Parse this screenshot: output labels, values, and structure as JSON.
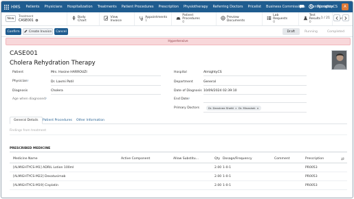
{
  "nav": {
    "app": "HMS",
    "menu": [
      "Patients",
      "Physicians",
      "Hospitalization",
      "Treatments",
      "Patient Procedures",
      "Prescription",
      "Physiotherapy",
      "Referring Doctors",
      "Pricelist",
      "Business Commissions",
      "Configuration"
    ],
    "company": "AlmightyCS"
  },
  "control": {
    "new_label": "New",
    "breadcrumb_parent": "Treatment",
    "breadcrumb_current": "CASE001",
    "smart_buttons": {
      "body_chart": "Body Chart",
      "view_invoice": "View Invoice",
      "appointments": "Appointments",
      "appointments_count": "1",
      "patient_procedures": "Patient Procedures",
      "patient_procedures_count": "0",
      "preview_documents": "Preview Documents",
      "lab_requests": "Lab Requests",
      "lab_requests_count": "0",
      "test_results": "Test Results",
      "test_results_count": "0",
      "more": "More"
    },
    "pager": "1 / 21"
  },
  "status_bar": {
    "confirm": "Confirm",
    "create_invoice": "Create Invoice",
    "cancel": "Cancel",
    "stages": [
      "Draft",
      "Running",
      "Completed"
    ],
    "active_stage": "Draft"
  },
  "ribbon": "Hypertensive",
  "record": {
    "reference": "CASE001",
    "title": "Cholera Rehydration Therapy",
    "left_fields": {
      "patient_label": "Patient",
      "patient_value": "Mrs. Hosine HARROUZI",
      "physician_label": "Physician",
      "physician_value": "Dr. Laxmi Patil",
      "diagnosis_label": "Diagnosis",
      "diagnosis_value": "Cholera",
      "age_label": "Age when diagnosed",
      "age_value": ""
    },
    "right_fields": {
      "hospital_label": "Hospital",
      "hospital_value": "AlmightyCS",
      "department_label": "Department",
      "department_value": "General",
      "date_label": "Date of Diagnosis",
      "date_value": "10/09/2024 02:39:10",
      "end_label": "End Date",
      "end_value": "",
      "primary_label": "Primary Doctors",
      "primary_doctors": [
        "Dr. Devshree Shetti",
        "Dr. Minashek"
      ]
    }
  },
  "tabs": [
    "General Details",
    "Patient Procedures",
    "Other Information"
  ],
  "findings_placeholder": "Findings from treatment",
  "medicine": {
    "section_title": "PRESCRIBED MEDICINE",
    "columns": [
      "Medicine Name",
      "Active Component",
      "Allow Substitu...",
      "Qty",
      "Dosage/Frequency",
      "Comment",
      "Prescription"
    ],
    "rows": [
      {
        "name": "[ALMIGHTYCS-M1] ADRIL Lotion 100ml",
        "active": "",
        "allow": "",
        "qty": "2.00",
        "dosage": "1-0-1",
        "comment": "",
        "prescription": "PR0053"
      },
      {
        "name": "[ALMIGHTYCS-M22] Dexatusimab",
        "active": "",
        "allow": "",
        "qty": "2.00",
        "dosage": "1-0-1",
        "comment": "",
        "prescription": "PR0053"
      },
      {
        "name": "[ALMIGHTYCS-M19] Cisplatin",
        "active": "",
        "allow": "",
        "qty": "2.00",
        "dosage": "1-0-1",
        "comment": "",
        "prescription": "PR0053"
      }
    ]
  },
  "colors": {
    "primary": "#1f5c8f",
    "ribbon_bg": "#f8d7da",
    "ribbon_text": "#8a3940",
    "avatar": "#e07b39"
  }
}
